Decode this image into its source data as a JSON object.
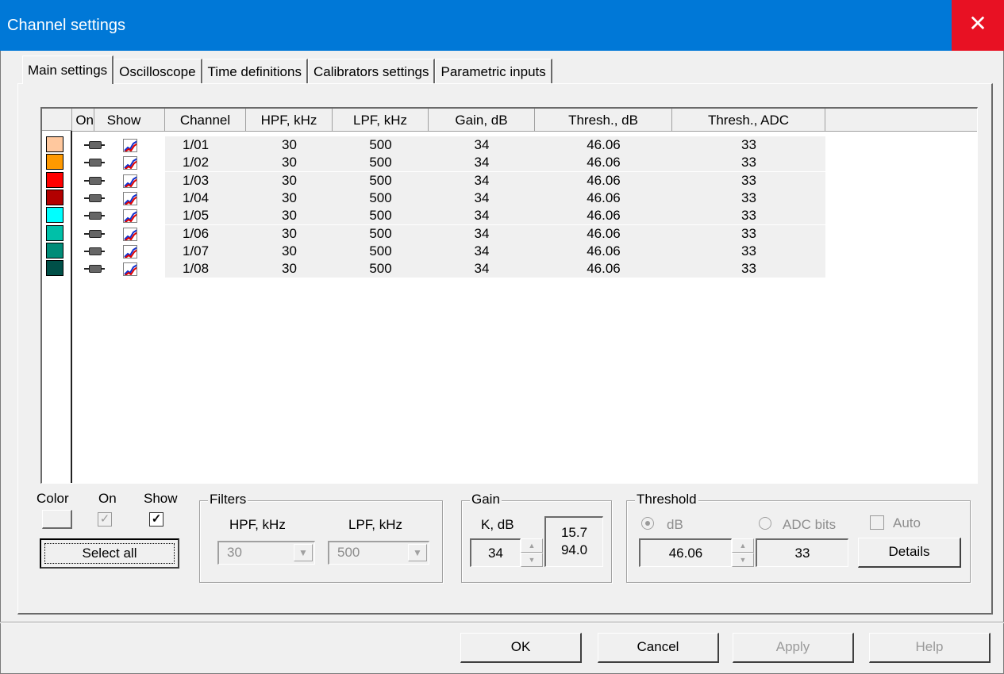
{
  "window": {
    "title": "Channel settings",
    "close_glyph": "✕"
  },
  "tabs": [
    {
      "label": "Main settings",
      "active": true
    },
    {
      "label": "Oscilloscope"
    },
    {
      "label": "Time definitions"
    },
    {
      "label": "Calibrators settings"
    },
    {
      "label": "Parametric inputs"
    }
  ],
  "grid": {
    "columns": [
      "On",
      "Show",
      "Channel",
      "HPF, kHz",
      "LPF, kHz",
      "Gain, dB",
      "Thresh., dB",
      "Thresh., ADC"
    ],
    "rows": [
      {
        "color": "#ffc89e",
        "channel": "1/01",
        "hpf": "30",
        "lpf": "500",
        "gain": "34",
        "thresh_db": "46.06",
        "thresh_adc": "33"
      },
      {
        "color": "#ff9900",
        "channel": "1/02",
        "hpf": "30",
        "lpf": "500",
        "gain": "34",
        "thresh_db": "46.06",
        "thresh_adc": "33"
      },
      {
        "color": "#ff0000",
        "channel": "1/03",
        "hpf": "30",
        "lpf": "500",
        "gain": "34",
        "thresh_db": "46.06",
        "thresh_adc": "33"
      },
      {
        "color": "#b20000",
        "channel": "1/04",
        "hpf": "30",
        "lpf": "500",
        "gain": "34",
        "thresh_db": "46.06",
        "thresh_adc": "33"
      },
      {
        "color": "#00ffff",
        "channel": "1/05",
        "hpf": "30",
        "lpf": "500",
        "gain": "34",
        "thresh_db": "46.06",
        "thresh_adc": "33"
      },
      {
        "color": "#00c0a8",
        "channel": "1/06",
        "hpf": "30",
        "lpf": "500",
        "gain": "34",
        "thresh_db": "46.06",
        "thresh_adc": "33"
      },
      {
        "color": "#008c78",
        "channel": "1/07",
        "hpf": "30",
        "lpf": "500",
        "gain": "34",
        "thresh_db": "46.06",
        "thresh_adc": "33"
      },
      {
        "color": "#005048",
        "channel": "1/08",
        "hpf": "30",
        "lpf": "500",
        "gain": "34",
        "thresh_db": "46.06",
        "thresh_adc": "33"
      }
    ]
  },
  "controls": {
    "color_label": "Color",
    "on_label": "On",
    "show_label": "Show",
    "on_check": "✓",
    "show_check": "✓",
    "select_all": "Select all",
    "filters": {
      "title": "Filters",
      "hpf_label": "HPF, kHz",
      "lpf_label": "LPF, kHz",
      "hpf_value": "30",
      "lpf_value": "500",
      "arrow": "▼"
    },
    "gain": {
      "title": "Gain",
      "k_label": "K, dB",
      "k_value": "34",
      "readout_1": "15.7",
      "readout_2": "94.0"
    },
    "threshold": {
      "title": "Threshold",
      "db_label": "dB",
      "adc_label": "ADC bits",
      "auto_label": "Auto",
      "db_value": "46.06",
      "adc_value": "33",
      "details": "Details"
    },
    "spin_up": "▲",
    "spin_down": "▼"
  },
  "buttons": {
    "ok": "OK",
    "cancel": "Cancel",
    "apply": "Apply",
    "help": "Help"
  }
}
